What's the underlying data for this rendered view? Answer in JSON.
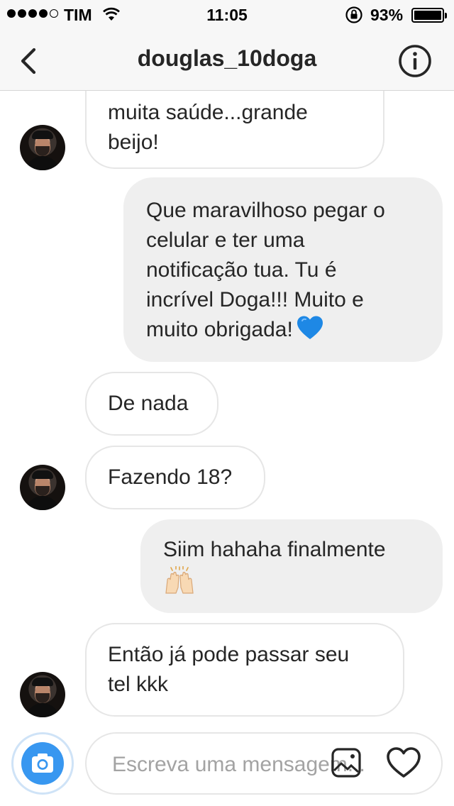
{
  "status_bar": {
    "carrier": "TIM",
    "time": "11:05",
    "battery_percent": "93%",
    "battery_level": 0.93,
    "signal_bars": 4,
    "icons": [
      "wifi-icon",
      "orientation-lock-icon",
      "battery-icon"
    ]
  },
  "header": {
    "title": "douglas_10doga",
    "back_icon": "chevron-left-icon",
    "info_icon": "info-icon"
  },
  "messages": [
    {
      "sender": "douglas_10doga",
      "direction": "incoming",
      "lines": [
        "muita saúde...grande",
        "beijo!"
      ]
    },
    {
      "sender": "me",
      "direction": "outgoing",
      "lines": [
        "Que maravilhoso pegar o",
        "celular e ter uma",
        "notificação tua. Tu é",
        "incrível Doga!!! Muito e",
        "muito obrigada!"
      ],
      "emoji": "blue-heart"
    },
    {
      "sender": "douglas_10doga",
      "direction": "incoming",
      "lines": [
        "De nada"
      ]
    },
    {
      "sender": "douglas_10doga",
      "direction": "incoming",
      "lines": [
        "Fazendo 18?"
      ]
    },
    {
      "sender": "me",
      "direction": "outgoing",
      "lines": [
        "Siim hahaha finalmente"
      ],
      "emoji": "raising-hands"
    },
    {
      "sender": "douglas_10doga",
      "direction": "incoming",
      "lines": [
        "Então já pode passar seu",
        "tel kkk"
      ]
    }
  ],
  "composer": {
    "placeholder": "Escreva uma mensagem...",
    "value": "",
    "camera_icon": "camera-icon",
    "gallery_icon": "gallery-icon",
    "like_icon": "heart-outline-icon"
  },
  "colors": {
    "accent": "#3897f0",
    "outgoing_bubble": "#efefef",
    "incoming_border": "#e6e6e6",
    "text": "#262626",
    "placeholder": "#a3a3a3",
    "emoji_blue_heart": "#1e88e5"
  }
}
